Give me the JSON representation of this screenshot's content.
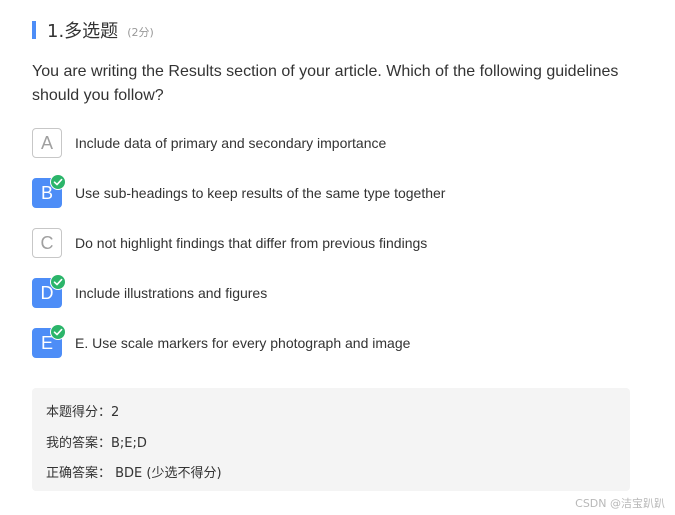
{
  "header": {
    "title": "1.多选题",
    "score": "(2分)"
  },
  "question": {
    "text": "You are writing the Results section of your article. Which of the following guidelines should you follow?"
  },
  "options": [
    {
      "letter": "A",
      "text": "Include data of primary and secondary importance",
      "selected": false
    },
    {
      "letter": "B",
      "text": "Use sub-headings to keep results of the same type together",
      "selected": true
    },
    {
      "letter": "C",
      "text": "Do not highlight findings that differ from previous findings",
      "selected": false
    },
    {
      "letter": "D",
      "text": "Include illustrations and figures",
      "selected": true
    },
    {
      "letter": "E",
      "text": "E. Use scale markers for every photograph and image",
      "selected": true
    }
  ],
  "result": {
    "score_line": "本题得分：2",
    "my_answer_line": "我的答案：B;E;D",
    "correct_answer_line": "正确答案： BDE (少选不得分)"
  },
  "watermark": "CSDN @洁宝趴趴",
  "colors": {
    "accent": "#4d8df7",
    "check": "#2bb56a",
    "result_bg": "#f4f4f4"
  }
}
